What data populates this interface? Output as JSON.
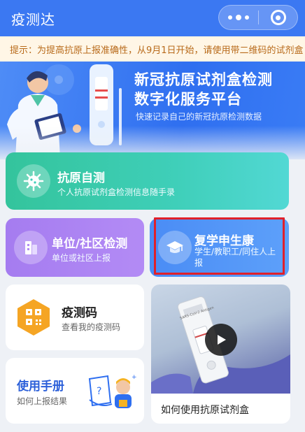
{
  "header": {
    "title": "疫测达"
  },
  "notice": {
    "text": "提示：为提高抗原上报准确性，从9月1日开始，请使用带二维码的试剂盒"
  },
  "banner": {
    "title_line1": "新冠抗原试剂盒检测",
    "title_line2": "数字化服务平台",
    "subtitle": "快速记录自己的新冠抗原检测数据"
  },
  "cards": {
    "antigen": {
      "title": "抗原自测",
      "subtitle": "个人抗原试剂盒检测信息随手录"
    },
    "unit": {
      "title": "单位/社区检测",
      "subtitle": "单位或社区上报"
    },
    "school": {
      "title": "复学申生康",
      "subtitle": "学生/教职工/同住人上报"
    },
    "code": {
      "title": "疫测码",
      "subtitle": "查看我的疫测码"
    },
    "manual": {
      "title": "使用手册",
      "subtitle": "如何上报结果"
    },
    "video": {
      "caption": "如何使用抗原试剂盒",
      "label": "SARS-CoV-2 Antigen"
    }
  },
  "colors": {
    "header": "#3b78f2",
    "highlight": "#e0202a",
    "antigen": "#34c49c",
    "unit": "#a57cf0",
    "school": "#4a8cf5",
    "code_icon": "#f5a524"
  }
}
